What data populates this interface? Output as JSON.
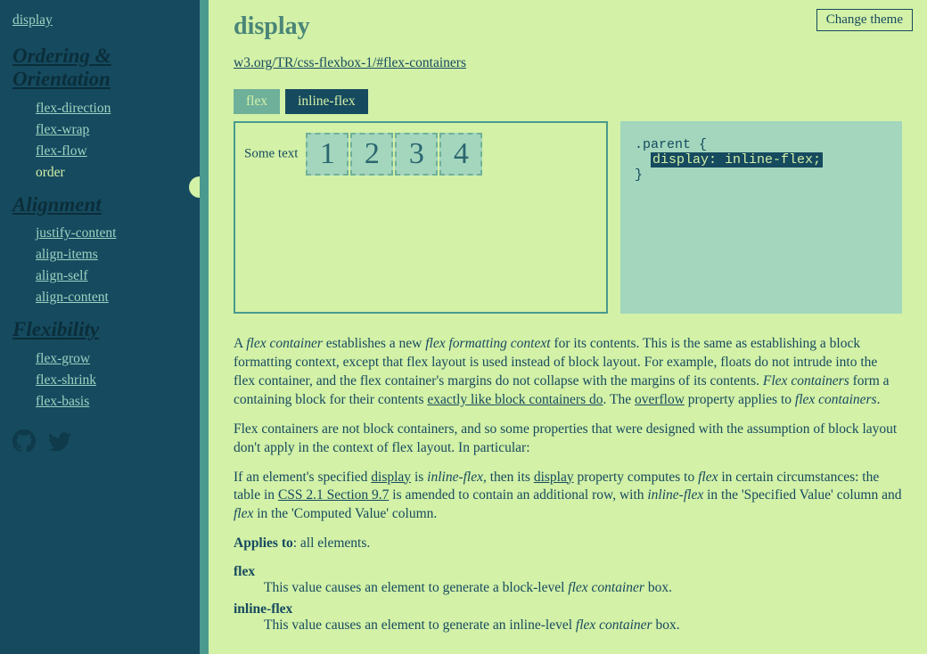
{
  "sidebar": {
    "top": "display",
    "groups": [
      {
        "heading": "Ordering & Orientation",
        "items": [
          {
            "label": "flex-direction",
            "active": false
          },
          {
            "label": "flex-wrap",
            "active": false
          },
          {
            "label": "flex-flow",
            "active": false
          },
          {
            "label": "order",
            "active": true
          }
        ]
      },
      {
        "heading": "Alignment",
        "items": [
          {
            "label": "justify-content",
            "active": false
          },
          {
            "label": "align-items",
            "active": false
          },
          {
            "label": "align-self",
            "active": false
          },
          {
            "label": "align-content",
            "active": false
          }
        ]
      },
      {
        "heading": "Flexibility",
        "items": [
          {
            "label": "flex-grow",
            "active": false
          },
          {
            "label": "flex-shrink",
            "active": false
          },
          {
            "label": "flex-basis",
            "active": false
          }
        ]
      }
    ]
  },
  "header": {
    "change_theme": "Change theme",
    "title": "display",
    "spec_link": "w3.org/TR/css-flexbox-1/#flex-containers"
  },
  "tabs": [
    {
      "label": "flex",
      "active": false
    },
    {
      "label": "inline-flex",
      "active": true
    }
  ],
  "demo": {
    "lead_text": "Some text",
    "items": [
      "1",
      "2",
      "3",
      "4"
    ]
  },
  "code": {
    "line1": ".parent {",
    "line2": "  ",
    "hl": "display: inline-flex;",
    "line3": "}"
  },
  "content": {
    "p1a": "A ",
    "p1_em1": "flex container",
    "p1b": " establishes a new ",
    "p1_em2": "flex formatting context",
    "p1c": " for its contents. This is the same as establishing a block formatting context, except that flex layout is used instead of block layout. For example, floats do not intrude into the flex container, and the flex container's margins do not collapse with the margins of its contents. ",
    "p1_em3": "Flex containers",
    "p1d": " form a containing block for their contents ",
    "p1_link1": "exactly like block containers do",
    "p1e": ". The ",
    "p1_link2": "overflow",
    "p1f": " property applies to ",
    "p1_em4": "flex containers",
    "p1g": ".",
    "p2": "Flex containers are not block containers, and so some properties that were designed with the assumption of block layout don't apply in the context of flex layout. In particular:",
    "p3a": "If an element's specified ",
    "p3_link1": "display",
    "p3b": " is ",
    "p3_em1": "inline-flex",
    "p3c": ", then its ",
    "p3_link2": "display",
    "p3d": " property computes to ",
    "p3_em2": "flex",
    "p3e": " in certain circumstances: the table in ",
    "p3_link3": "CSS 2.1 Section 9.7",
    "p3f": " is amended to contain an additional row, with ",
    "p3_em3": "inline-flex",
    "p3g": " in the 'Specified Value' column and ",
    "p3_em4": "flex",
    "p3h": " in the 'Computed Value' column.",
    "p4_strong": "Applies to",
    "p4_rest": ": all elements.",
    "dl": [
      {
        "term": "flex",
        "def_a": "This value causes an element to generate a block-level ",
        "def_em": "flex container",
        "def_b": " box."
      },
      {
        "term": "inline-flex",
        "def_a": "This value causes an element to generate an inline-level ",
        "def_em": "flex container",
        "def_b": " box."
      }
    ]
  }
}
